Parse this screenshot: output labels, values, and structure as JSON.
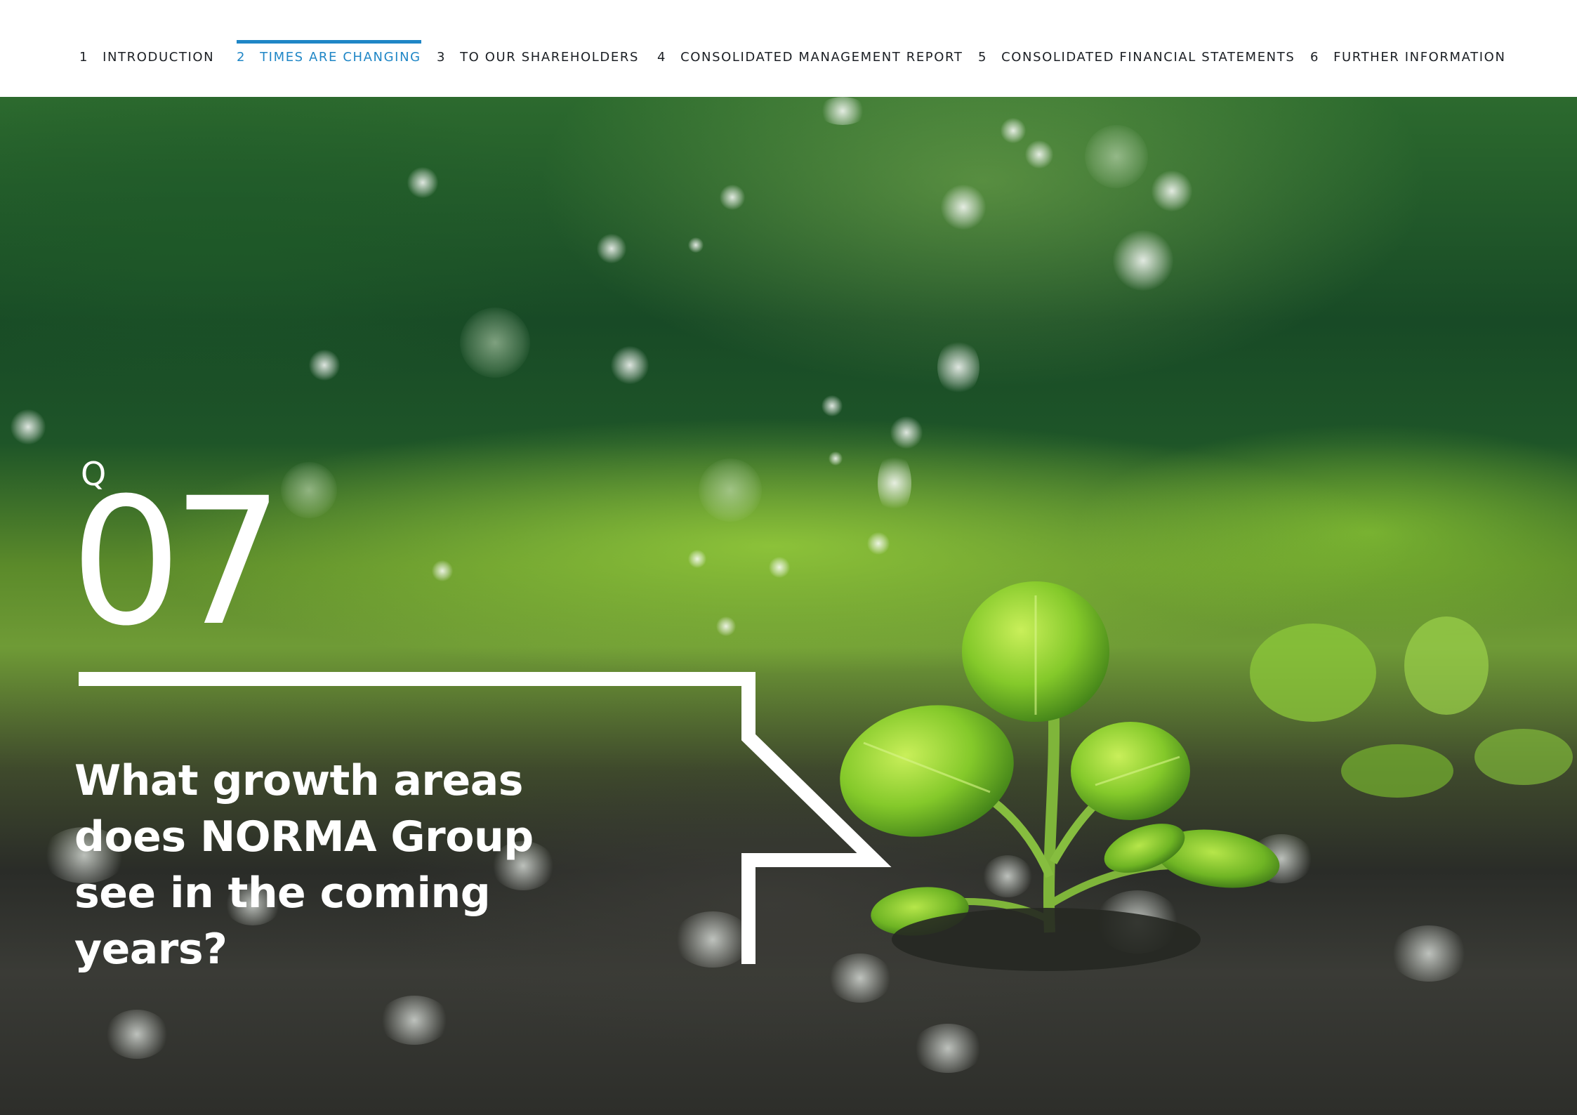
{
  "nav": {
    "items": [
      {
        "num": "1",
        "label": "INTRODUCTION",
        "active": false
      },
      {
        "num": "2",
        "label": "TIMES ARE CHANGING",
        "active": true
      },
      {
        "num": "3",
        "label": "TO OUR SHAREHOLDERS",
        "active": false
      },
      {
        "num": "4",
        "label": "CONSOLIDATED MANAGEMENT REPORT",
        "active": false
      },
      {
        "num": "5",
        "label": "CONSOLIDATED FINANCIAL STATEMENTS",
        "active": false
      },
      {
        "num": "6",
        "label": "FURTHER INFORMATION",
        "active": false
      }
    ],
    "colors": {
      "text": "#1b1f24",
      "active": "#1f86c6"
    }
  },
  "hero": {
    "image": "seedling-in-soil-with-water-droplets",
    "question": {
      "prefix": "Q",
      "number": "07",
      "text": "What growth areas does NORMA Group see in the coming years?"
    }
  }
}
